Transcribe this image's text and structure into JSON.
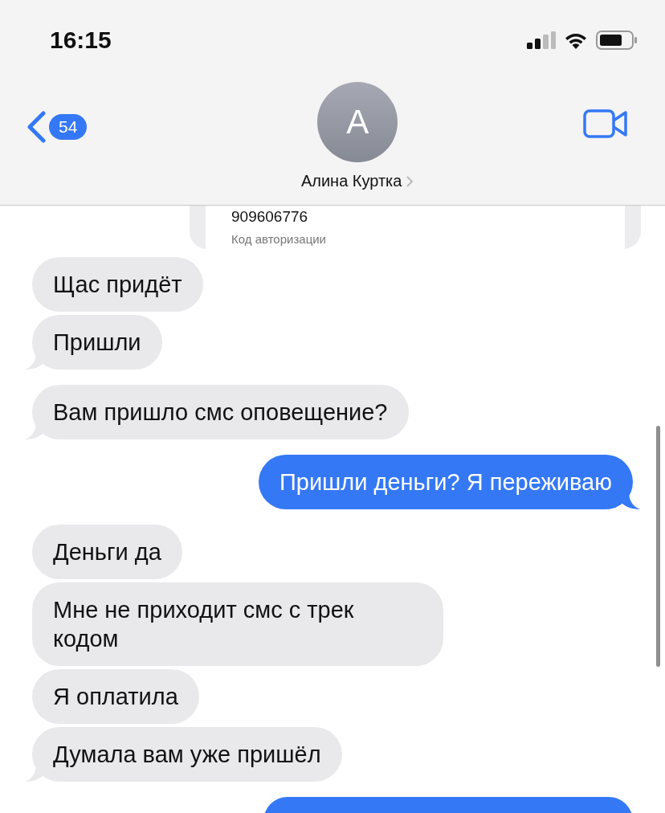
{
  "status_bar": {
    "time": "16:15"
  },
  "header": {
    "back_count": "54",
    "avatar_initial": "А",
    "contact_name": "Алина Куртка"
  },
  "shared_card": {
    "number": "909606776",
    "caption": "Код авторизации"
  },
  "messages": [
    {
      "kind": "incoming",
      "text": "Щас придёт",
      "tail": false
    },
    {
      "kind": "incoming",
      "text": "Пришли",
      "tail": true
    },
    {
      "kind": "incoming",
      "text": "Вам пришло смс оповещение?",
      "tail": true
    },
    {
      "kind": "outgoing",
      "text": "Пришли деньги? Я переживаю",
      "tail": true
    },
    {
      "kind": "incoming",
      "text": "Деньги да",
      "tail": false
    },
    {
      "kind": "incoming",
      "text": "Мне не приходит смс с трек кодом",
      "tail": false
    },
    {
      "kind": "incoming",
      "text": "Я оплатила",
      "tail": false
    },
    {
      "kind": "incoming",
      "text": "Думала вам уже пришёл",
      "tail": true
    }
  ],
  "partial_message": {
    "kind": "outgoing"
  }
}
